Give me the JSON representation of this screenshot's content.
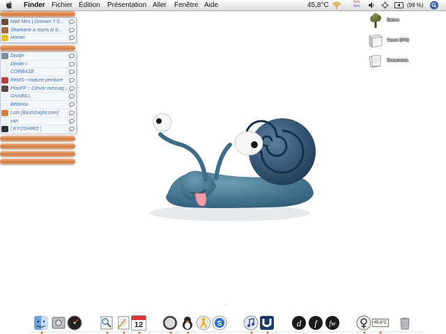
{
  "menubar": {
    "apple": "apple-icon",
    "items": [
      "Finder",
      "Fichier",
      "Édition",
      "Présentation",
      "Aller",
      "Fenêtre",
      "Aide"
    ],
    "temperature": "45,8°C",
    "network_top": "0o/s",
    "network_bottom": "0o/s",
    "battery": "(99 %)",
    "icons": [
      "wifi-icon",
      "network-meter-icon",
      "volume-icon",
      "bluetooth-icon",
      "sync-icon",
      "battery-icon",
      "spotlight-icon"
    ]
  },
  "buddy_list": {
    "group1_rows": [
      {
        "name": "Matt Mini | Demain ? S...",
        "avatar_color": "#6b4a3a"
      },
      {
        "name": "Sharkane a repris le b...",
        "avatar_color": "#a86a40"
      },
      {
        "name": "Homer",
        "avatar_color": "#e0c020"
      }
    ],
    "group2_rows": [
      {
        "name": "Djodje",
        "avatar_color": "#7a8aa0"
      },
      {
        "name": "Dimitri !",
        "avatar_color": "#f0f0f0"
      },
      {
        "name": "CORBASE",
        "avatar_color": "#f0f0f0"
      },
      {
        "name": "ReMS-->nature peinture",
        "avatar_color": "#b04040"
      },
      {
        "name": "PlooFF :: Clever messag...",
        "avatar_color": "#5a4a4a"
      },
      {
        "name": "GrosBILL",
        "avatar_color": "#f0f0f0"
      },
      {
        "name": "Bébinou",
        "avatar_color": "#f0f0f0"
      },
      {
        "name": "Lolo [Bash2night.com]",
        "avatar_color": "#d08040"
      },
      {
        "name": "yan",
        "avatar_color": "#f0f0f0"
      },
      {
        "name": "¦ KYOSHIRO ¦",
        "avatar_color": "#303030"
      }
    ],
    "accent": "#3c6fb0",
    "group_color": "#d07a42"
  },
  "desktop_icons": [
    {
      "label": "Baboo",
      "icon": "tree-icon"
    },
    {
      "label": "Cours EPSI",
      "icon": "folder-icon"
    },
    {
      "label": "Documents",
      "icon": "documents-icon"
    }
  ],
  "dock": {
    "items": [
      "finder-icon",
      "system-preferences-icon",
      "dashboard-icon",
      "preview-icon",
      "textedit-icon",
      "ical-icon",
      "safari-icon",
      "adium-icon",
      "aim-icon",
      "skype-icon",
      "itunes-icon",
      "utorrent-icon",
      "dreamweaver-icon",
      "flash-icon",
      "fireworks-icon",
      "adium-menu-icon",
      "temperature-monitor-icon",
      "trash-icon"
    ],
    "calendar_day": "12",
    "temperature": "45,8°C"
  }
}
